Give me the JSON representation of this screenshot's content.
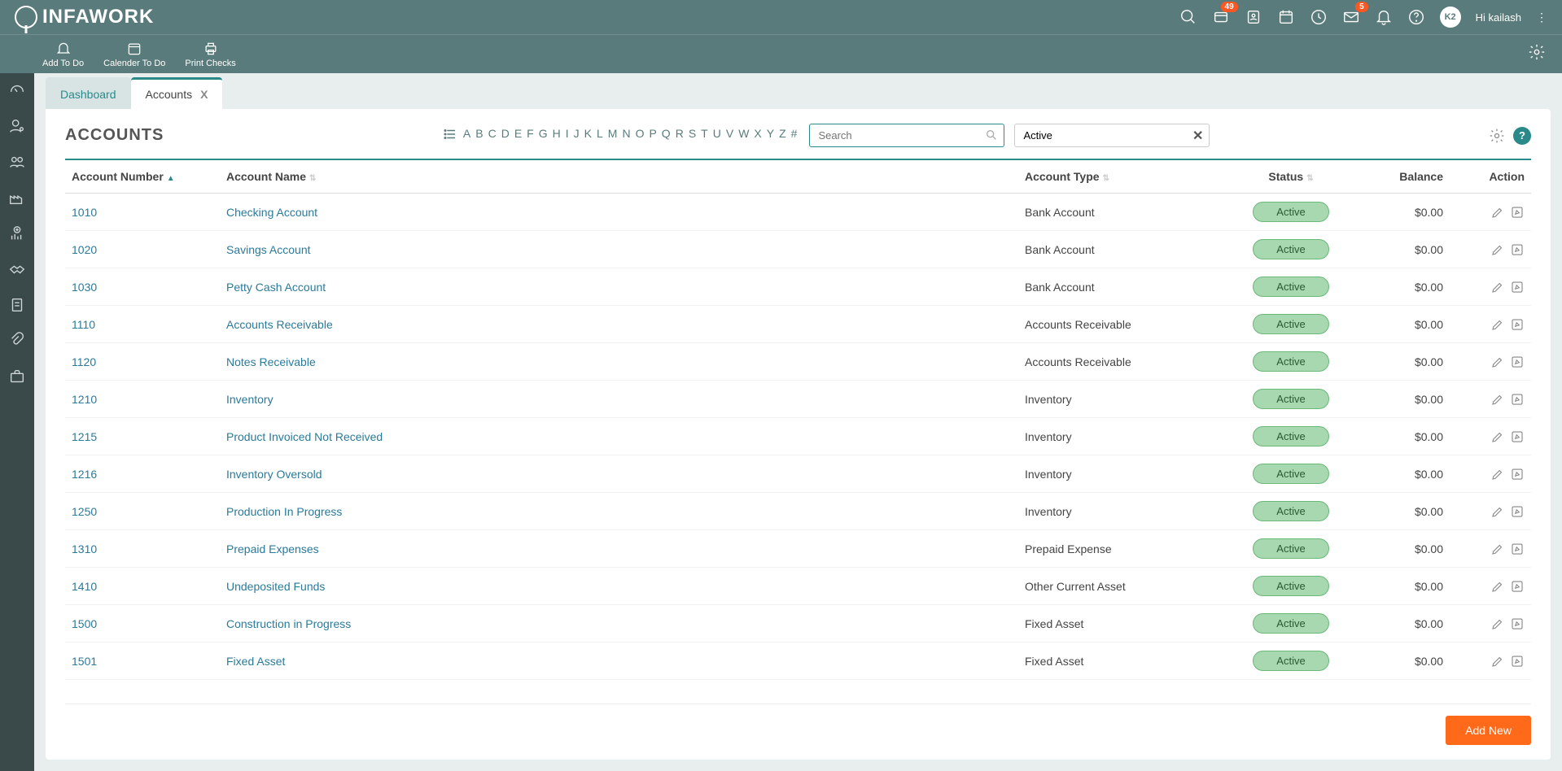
{
  "brand": "INFAWORK",
  "badges": {
    "notif1": "49",
    "mail": "5"
  },
  "user": {
    "avatar": "K2",
    "greeting": "Hi kailash"
  },
  "toolbar": [
    {
      "label": "Add To Do"
    },
    {
      "label": "Calender To Do"
    },
    {
      "label": "Print Checks"
    }
  ],
  "tabs": [
    {
      "label": "Dashboard",
      "closable": false
    },
    {
      "label": "Accounts",
      "closable": true
    }
  ],
  "page_title": "ACCOUNTS",
  "alpha": [
    "A",
    "B",
    "C",
    "D",
    "E",
    "F",
    "G",
    "H",
    "I",
    "J",
    "K",
    "L",
    "M",
    "N",
    "O",
    "P",
    "Q",
    "R",
    "S",
    "T",
    "U",
    "V",
    "W",
    "X",
    "Y",
    "Z",
    "#"
  ],
  "search": {
    "placeholder": "Search"
  },
  "filter": {
    "value": "Active"
  },
  "columns": {
    "number": "Account Number",
    "name": "Account Name",
    "type": "Account Type",
    "status": "Status",
    "balance": "Balance",
    "action": "Action"
  },
  "rows": [
    {
      "num": "1010",
      "name": "Checking Account",
      "type": "Bank Account",
      "status": "Active",
      "balance": "$0.00"
    },
    {
      "num": "1020",
      "name": "Savings Account",
      "type": "Bank Account",
      "status": "Active",
      "balance": "$0.00"
    },
    {
      "num": "1030",
      "name": "Petty Cash Account",
      "type": "Bank Account",
      "status": "Active",
      "balance": "$0.00"
    },
    {
      "num": "1110",
      "name": "Accounts Receivable",
      "type": "Accounts Receivable",
      "status": "Active",
      "balance": "$0.00"
    },
    {
      "num": "1120",
      "name": "Notes Receivable",
      "type": "Accounts Receivable",
      "status": "Active",
      "balance": "$0.00"
    },
    {
      "num": "1210",
      "name": "Inventory",
      "type": "Inventory",
      "status": "Active",
      "balance": "$0.00"
    },
    {
      "num": "1215",
      "name": "Product Invoiced Not Received",
      "type": "Inventory",
      "status": "Active",
      "balance": "$0.00"
    },
    {
      "num": "1216",
      "name": "Inventory Oversold",
      "type": "Inventory",
      "status": "Active",
      "balance": "$0.00"
    },
    {
      "num": "1250",
      "name": "Production In Progress",
      "type": "Inventory",
      "status": "Active",
      "balance": "$0.00"
    },
    {
      "num": "1310",
      "name": "Prepaid Expenses",
      "type": "Prepaid Expense",
      "status": "Active",
      "balance": "$0.00"
    },
    {
      "num": "1410",
      "name": "Undeposited Funds",
      "type": "Other Current Asset",
      "status": "Active",
      "balance": "$0.00"
    },
    {
      "num": "1500",
      "name": "Construction in Progress",
      "type": "Fixed Asset",
      "status": "Active",
      "balance": "$0.00"
    },
    {
      "num": "1501",
      "name": "Fixed Asset",
      "type": "Fixed Asset",
      "status": "Active",
      "balance": "$0.00"
    }
  ],
  "add_button": "Add New"
}
